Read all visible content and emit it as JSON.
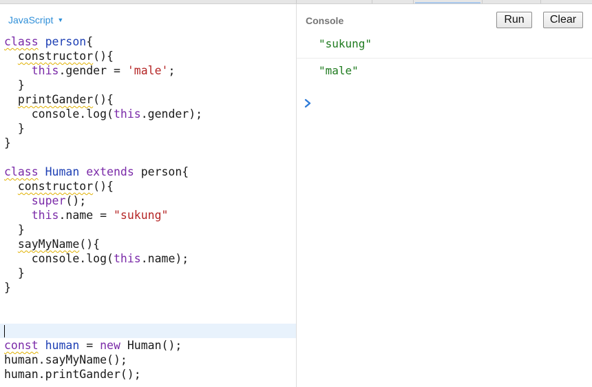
{
  "editor": {
    "language": "JavaScript",
    "lines": [
      {
        "segments": [
          {
            "t": "class",
            "c": "kw sq"
          },
          {
            "t": " "
          },
          {
            "t": "person",
            "c": "def"
          },
          {
            "t": "{"
          }
        ]
      },
      {
        "segments": [
          {
            "t": "  "
          },
          {
            "t": "constructor",
            "c": "sq"
          },
          {
            "t": "(){"
          }
        ]
      },
      {
        "segments": [
          {
            "t": "    "
          },
          {
            "t": "this",
            "c": "kw"
          },
          {
            "t": ".gender = "
          },
          {
            "t": "'male'",
            "c": "str"
          },
          {
            "t": ";"
          }
        ]
      },
      {
        "segments": [
          {
            "t": "  }"
          }
        ]
      },
      {
        "segments": [
          {
            "t": "  "
          },
          {
            "t": "printGander",
            "c": "sq"
          },
          {
            "t": "(){"
          }
        ]
      },
      {
        "segments": [
          {
            "t": "    console.log("
          },
          {
            "t": "this",
            "c": "kw"
          },
          {
            "t": ".gender);"
          }
        ]
      },
      {
        "segments": [
          {
            "t": "  }"
          }
        ]
      },
      {
        "segments": [
          {
            "t": "}"
          }
        ]
      },
      {
        "segments": []
      },
      {
        "segments": [
          {
            "t": "class",
            "c": "kw sq"
          },
          {
            "t": " "
          },
          {
            "t": "Human",
            "c": "def"
          },
          {
            "t": " "
          },
          {
            "t": "extends",
            "c": "kw"
          },
          {
            "t": " person{"
          }
        ]
      },
      {
        "segments": [
          {
            "t": "  "
          },
          {
            "t": "constructor",
            "c": "sq"
          },
          {
            "t": "(){"
          }
        ]
      },
      {
        "segments": [
          {
            "t": "    "
          },
          {
            "t": "super",
            "c": "kw"
          },
          {
            "t": "();"
          }
        ]
      },
      {
        "segments": [
          {
            "t": "    "
          },
          {
            "t": "this",
            "c": "kw"
          },
          {
            "t": ".name = "
          },
          {
            "t": "\"sukung\"",
            "c": "str"
          }
        ]
      },
      {
        "segments": [
          {
            "t": "  }"
          }
        ]
      },
      {
        "segments": [
          {
            "t": "  "
          },
          {
            "t": "sayMyName",
            "c": "sq"
          },
          {
            "t": "(){"
          }
        ]
      },
      {
        "segments": [
          {
            "t": "    console.log("
          },
          {
            "t": "this",
            "c": "kw"
          },
          {
            "t": ".name);"
          }
        ]
      },
      {
        "segments": [
          {
            "t": "  }"
          }
        ]
      },
      {
        "segments": [
          {
            "t": "}"
          }
        ]
      },
      {
        "segments": []
      },
      {
        "segments": []
      },
      {
        "segments": [],
        "active": true
      },
      {
        "segments": [
          {
            "t": "const",
            "c": "kw sq"
          },
          {
            "t": " "
          },
          {
            "t": "human",
            "c": "def"
          },
          {
            "t": " = "
          },
          {
            "t": "new",
            "c": "kw"
          },
          {
            "t": " Human();"
          }
        ]
      },
      {
        "segments": [
          {
            "t": "human.sayMyName();"
          }
        ]
      },
      {
        "segments": [
          {
            "t": "human.printGander();"
          }
        ]
      }
    ]
  },
  "console": {
    "title": "Console",
    "run_label": "Run",
    "clear_label": "Clear",
    "outputs": [
      "\"sukung\"",
      "\"male\""
    ]
  },
  "colors": {
    "keyword": "#7a2aa8",
    "definition": "#1d3fb4",
    "string": "#b52626",
    "output": "#1e7a1e",
    "language_link": "#2f8fd8",
    "prompt": "#2f7bd8"
  },
  "icons": {
    "language_caret": "caret-down-icon",
    "prompt": "chevron-right-icon"
  }
}
